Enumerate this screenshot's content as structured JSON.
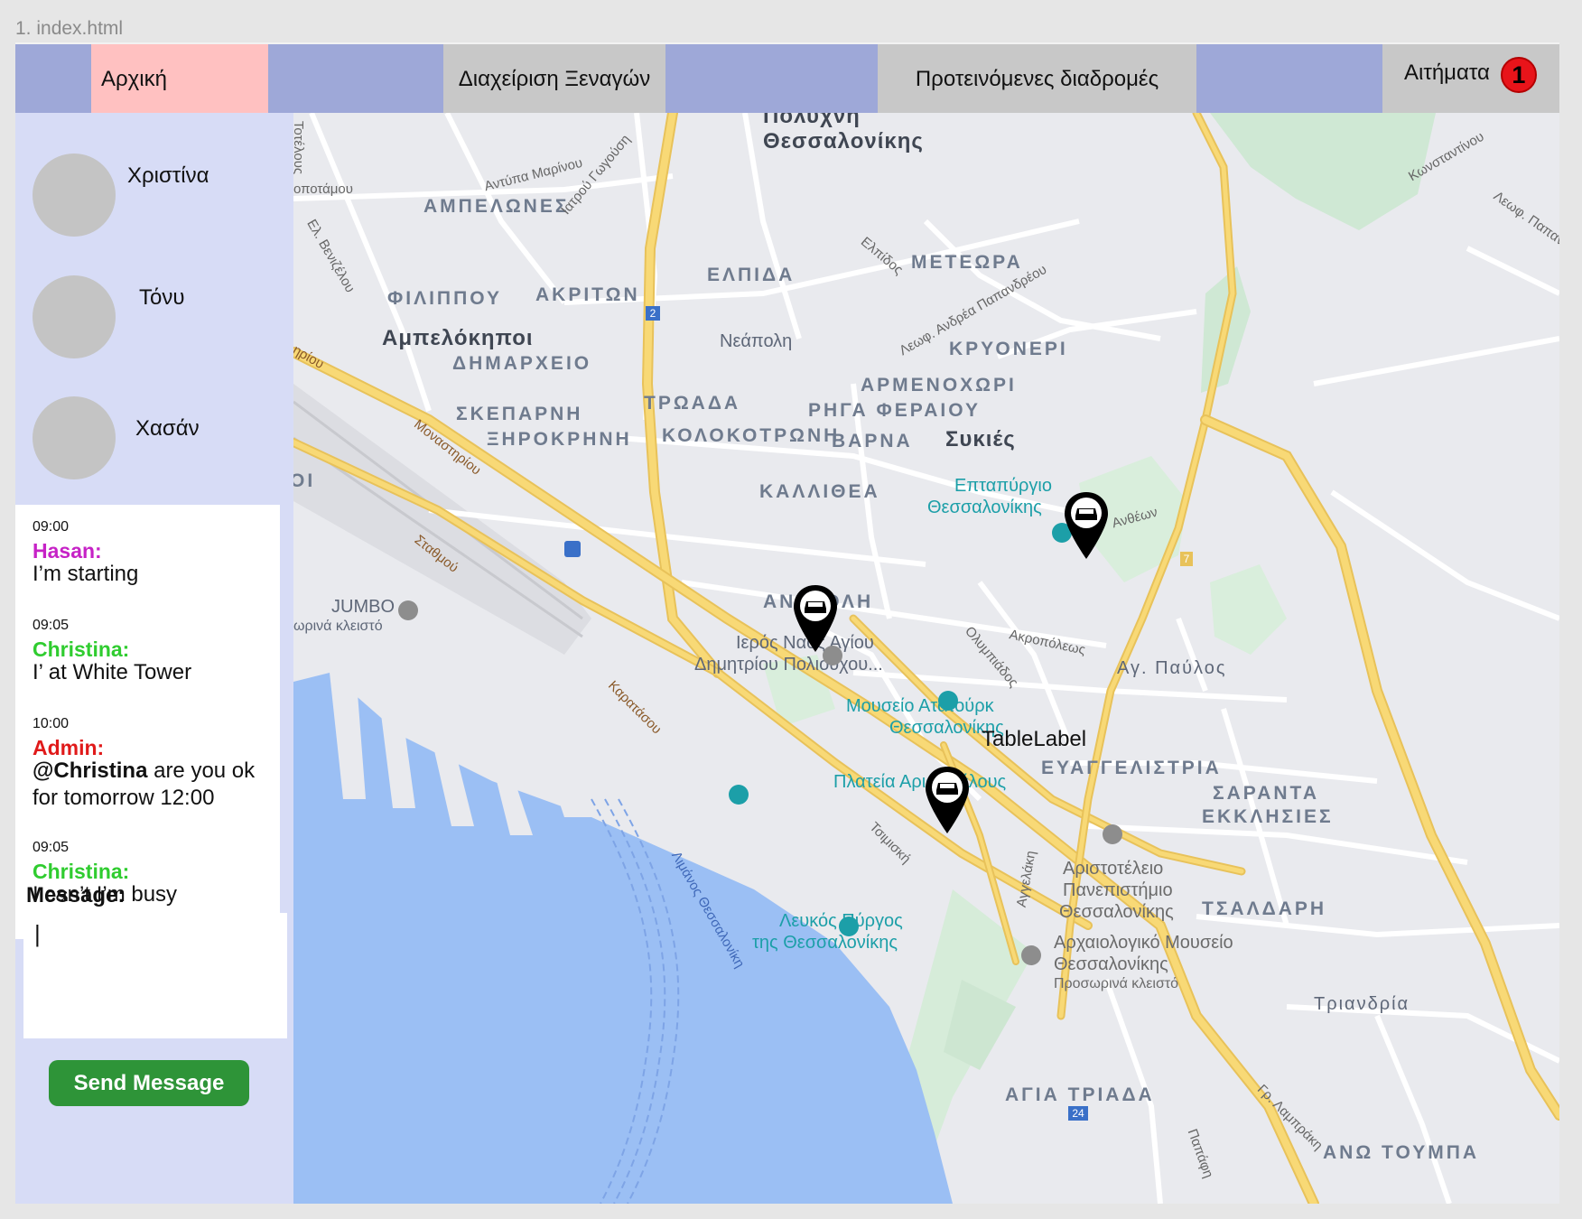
{
  "file_label": "1. index.html",
  "nav": {
    "home": "Αρχική",
    "guides": "Διαχείριση Ξεναγών",
    "routes": "Προτεινόμενες διαδρομές",
    "requests": "Αιτήματα",
    "requests_count": "1"
  },
  "users": [
    "Χριστίνα",
    "Τόνυ",
    "Χασάν"
  ],
  "chat": {
    "messages": [
      {
        "time": "09:00",
        "author": "Hasan:",
        "text": "I’m starting",
        "color": "#c622c6"
      },
      {
        "time": "09:05",
        "author": "Christina:",
        "text": "I’ at White Tower",
        "color": "#2fcc2f"
      },
      {
        "time": "10:00",
        "author": "Admin:",
        "mention": "@Christina",
        "text": " are you ok for tomorrow 12:00",
        "color": "#e01a1a"
      },
      {
        "time": "09:05",
        "author": "Christina:",
        "text": "I can’t I’m busy",
        "color": "#2fcc2f"
      }
    ],
    "message_label": "Message:",
    "input_value": "|",
    "send_label": "Send Message"
  },
  "map": {
    "table_label": "TableLabel",
    "labels": {
      "politechni": "Πολυχνη",
      "thessalonikis_top": "Θεσσαλονίκης",
      "ampelones": "ΑΜΠΕΛΩΝΕΣ",
      "elpida": "ΕΛΠΙΔΑ",
      "meteora": "ΜΕΤΕΩΡΑ",
      "filippou": "ΦΙΛΙΠΠΟΥ",
      "akriton": "ΑΚΡΙΤΩΝ",
      "ampelokipoi": "Αμπελόκηποι",
      "dimarxeio": "ΔΗΜΑΡΧΕΙΟ",
      "neapoli": "Νεάπολη",
      "kryoneri": "ΚΡΥΟΝΕΡΙ",
      "armenoxori": "ΑΡΜΕΝΟΧΩΡΙ",
      "riga_feraiou": "ΡΗΓΑ ΦΕΡΑΙΟΥ",
      "skeparni": "ΣΚΕΠΑΡΝΗ",
      "troada": "ΤΡΩΑΔΑ",
      "xirokrini": "ΞΗΡΟΚΡΗΝΗ",
      "kolokotroni": "ΚΟΛΟΚΟΤΡΩΝΗ",
      "varna": "ΒΑΡΝΑ",
      "sykies": "Συκιές",
      "kallithea": "ΚΑΛΛΙΘΕΑ",
      "eptapyrgio": "Επταπύργιο",
      "eptapyrgio2": "Θεσσαλονίκης",
      "anthon": "Ανθέων",
      "jumbo": "JUMBO",
      "jumbo2": "ωρινά κλειστό",
      "anatoli": "ΑΝΑΤΟΛΗ",
      "ieros_naos": "Ιερός Ναός Αγίου",
      "ieros_naos2": "Δημητρίου Πολιούχου...",
      "akropoleos": "Ακροπόλεως",
      "olympiados": "Ολυμπιάδος",
      "ag_pavlos": "Αγ. Παύλος",
      "ataturk": "Μουσείο Ατατούρκ",
      "ataturk2": "Θεσσαλονίκης",
      "evaggelistria": "ΕΥΑΓΓΕΛΙΣΤΡΙΑ",
      "saranta": "ΣΑΡΑΝΤΑ",
      "ekklisies": "ΕΚΚΛΗΣΙΕΣ",
      "plateia": "Πλατεία Αριστοτέλους",
      "tsimiski": "Τσιμισκή",
      "aristoteleio": "Αριστοτέλειο",
      "aristoteleio2": "Πανεπιστήμιο",
      "aristoteleio3": "Θεσσαλονίκης",
      "tsaldari": "ΤΣΑΛΔΑΡΗ",
      "lefkos": "Λευκός Πύργος",
      "lefkos2": "της Θεσσαλονίκης",
      "arxaiologiko": "Αρχαιολογικό Μουσείο",
      "arxaiologiko2": "Θεσσαλονίκης",
      "arxaiologiko3": "Προσωρινά κλειστό",
      "aggelaki": "Αγγελάκη",
      "triandria": "Τριανδρία",
      "agia_triada": "ΑΓΙΑ ΤΡΙΑΔΑ",
      "ano_toumpa": "ΑΝΩ ΤΟΥΜΠΑ",
      "monastiriou": "Μοναστηρίου",
      "stathmou": "Σταθμού",
      "karatasou": "Καρατάσου",
      "limenas": "Λιμάνος Θεσσαλονίκη",
      "antypa": "Αντύπα Μαρίνου",
      "iatrou": "Ιατρού Γωγούση",
      "elpidos": "Ελπίδος",
      "papandreou": "Λεωφ. Ανδρέα Παπανδρέου",
      "konstantinou": "Κωνσταντίνου",
      "papanikolaou": "Λεωφ. Παπανικολ",
      "venizelou": "Ελ. Βενιζέλου",
      "potamou": "οποτάμου",
      "totelous": "Τοτέλους",
      "gr_lampraki": "Γρ. Λαμπράκη",
      "papafi": "Παπάφη",
      "iriou": "ηρίου",
      "oi": "ΟΙ",
      "route_2": "2",
      "route_7": "7",
      "route_24": "24"
    }
  }
}
